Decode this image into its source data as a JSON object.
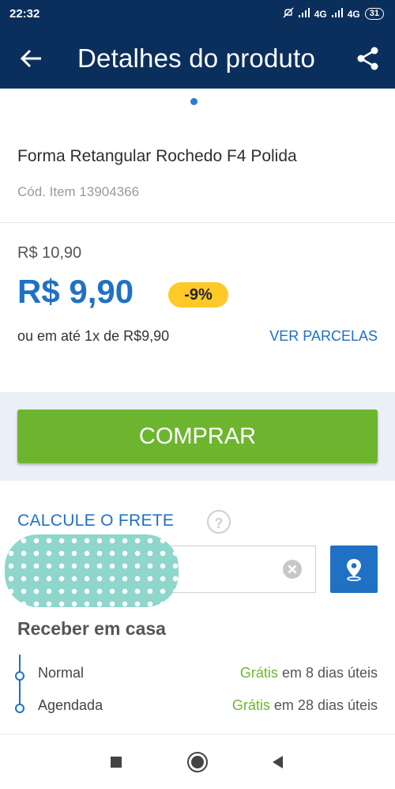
{
  "status_bar": {
    "time": "22:32",
    "network1": "4G",
    "network2": "4G",
    "battery": "31"
  },
  "app_bar": {
    "title": "Detalhes do produto",
    "back_icon": "arrow-back-icon",
    "share_icon": "share-icon"
  },
  "product": {
    "name": "Forma Retangular Rochedo F4 Polida",
    "code": "Cód. Item 13904366"
  },
  "price": {
    "old": "R$ 10,90",
    "new": "R$ 9,90",
    "discount": "-9%",
    "installments": "ou em até 1x de R$9,90",
    "ver_parcelas": "VER PARCELAS"
  },
  "buy": {
    "label": "COMPRAR"
  },
  "frete": {
    "title": "CALCULE O FRETE",
    "help": "?",
    "receber_title": "Receber em casa",
    "options": [
      {
        "name": "Normal",
        "gratis": "Grátis",
        "prazo": "em 8 dias úteis"
      },
      {
        "name": "Agendada",
        "gratis": "Grátis",
        "prazo": "em 28 dias úteis"
      }
    ]
  },
  "colors": {
    "header": "#0b2f5c",
    "accent": "#2071c4",
    "buy": "#6eb52f",
    "discount": "#ffc928"
  }
}
